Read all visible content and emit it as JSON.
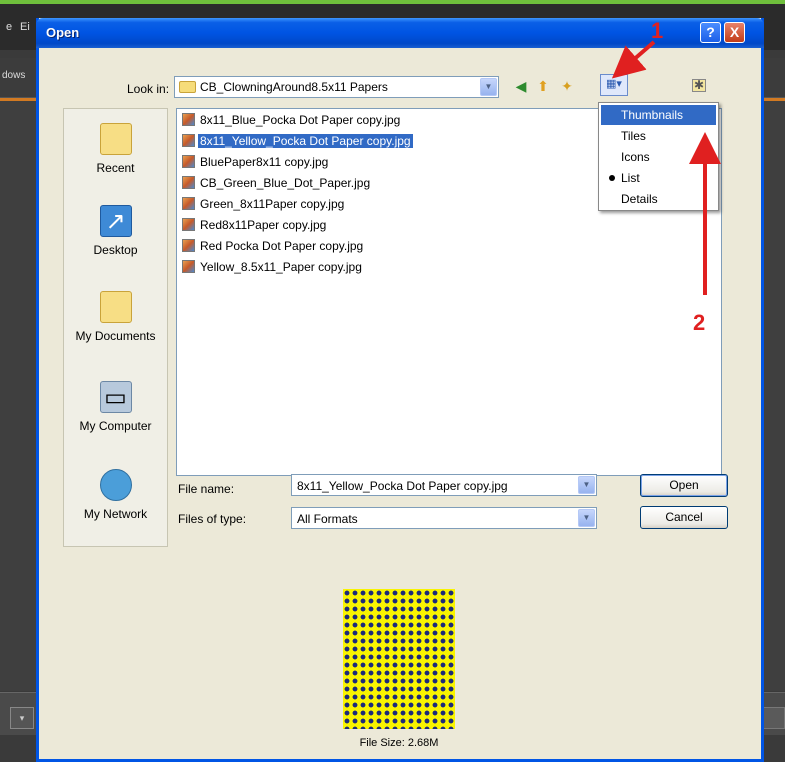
{
  "background_app": {
    "menu_fragment_1": "e",
    "menu_fragment_2": "Ei",
    "panel_fragment": "dows"
  },
  "dialog": {
    "title": "Open",
    "help_symbol": "?",
    "close_symbol": "X",
    "look_in_label": "Look in:",
    "look_in_value": "CB_ClowningAround8.5x11 Papers",
    "places": [
      {
        "label": "Recent"
      },
      {
        "label": "Desktop"
      },
      {
        "label": "My Documents"
      },
      {
        "label": "My Computer"
      },
      {
        "label": "My Network"
      }
    ],
    "files": [
      "8x11_Blue_Pocka Dot Paper copy.jpg",
      "8x11_Yellow_Pocka Dot Paper copy.jpg",
      "BluePaper8x11 copy.jpg",
      "CB_Green_Blue_Dot_Paper.jpg",
      "Green_8x11Paper copy.jpg",
      "Red8x11Paper copy.jpg",
      "Red Pocka Dot Paper copy.jpg",
      "Yellow_8.5x11_Paper copy.jpg"
    ],
    "selected_file_index": 1,
    "views_menu": {
      "items": [
        "Thumbnails",
        "Tiles",
        "Icons",
        "List",
        "Details"
      ],
      "highlighted": "Thumbnails",
      "checked": "List"
    },
    "file_name_label": "File name:",
    "file_name_value": "8x11_Yellow_Pocka Dot Paper copy.jpg",
    "files_of_type_label": "Files of type:",
    "files_of_type_value": "All Formats",
    "open_button": "Open",
    "cancel_button": "Cancel",
    "file_size": "File Size: 2.68M"
  },
  "annotations": {
    "step1": "1",
    "step2": "2",
    "color": "#e02020"
  },
  "colors": {
    "title_bar": "#0054e3",
    "selection": "#316ac5",
    "dialog_bg": "#ece9d8",
    "preview_paper": "#f9f400",
    "preview_dots": "#1b2a7a"
  }
}
